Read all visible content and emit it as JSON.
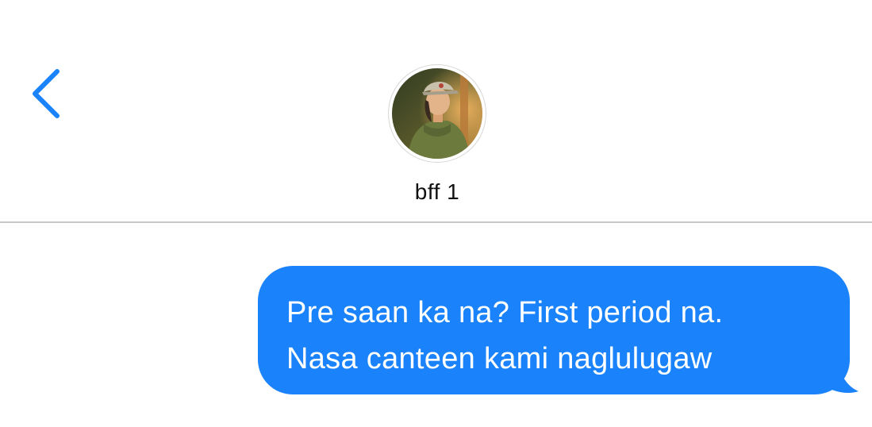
{
  "header": {
    "back_icon": "chevron-left-icon",
    "avatar_icon": "contact-photo",
    "contact_name": "bff 1",
    "accent_color": "#1a82fb"
  },
  "messages": [
    {
      "direction": "outgoing",
      "bubble_color": "#1a82fb",
      "lines": [
        "Pre saan ka na? First period na.",
        "Nasa canteen kami naglulugaw"
      ]
    }
  ]
}
